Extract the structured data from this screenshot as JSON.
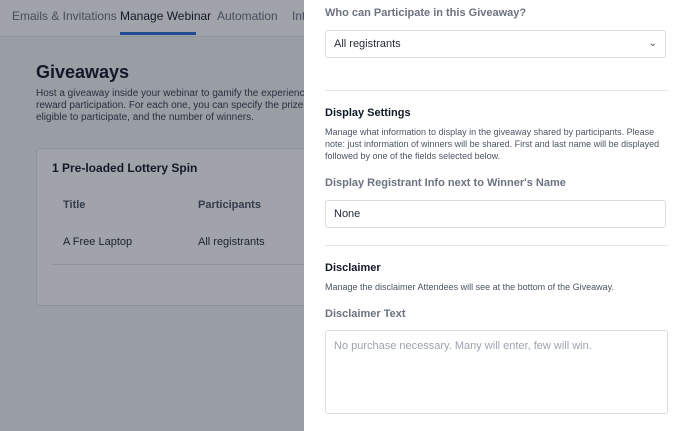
{
  "tabs": [
    {
      "label": "Emails & Invitations"
    },
    {
      "label": "Manage Webinar",
      "active": true
    },
    {
      "label": "Automation"
    },
    {
      "label": "Int"
    }
  ],
  "giveaways": {
    "title": "Giveaways",
    "description": "Host a giveaway inside your webinar to gamify the experience and reward participation. For each one, you can specify the prize, who's eligible to participate, and the number of winners.",
    "description_lines": [
      "Host a giveaway inside your webinar to gamify the experience and",
      "reward participation. For each one, you can specify the prize, who's",
      "eligible to participate, and the number of winners."
    ],
    "card_title": "1 Pre-loaded Lottery Spin",
    "columns": [
      "Title",
      "Participants"
    ],
    "rows": [
      {
        "title": "A Free Laptop",
        "participants": "All registrants"
      }
    ]
  },
  "drawer": {
    "participate_label": "Who can Participate in this Giveaway?",
    "participate_value": "All registrants",
    "display_heading": "Display Settings",
    "display_help": "Manage what information to display in the giveaway shared by participants. Please note: just information of winners will be shared. First and last name will be displayed followed by one of the fields selected below.",
    "registrant_label": "Display Registrant Info next to Winner's Name",
    "registrant_value": "None",
    "disclaimer_heading": "Disclaimer",
    "disclaimer_help": "Manage the disclaimer Attendees will see at the bottom of the Giveaway.",
    "disclaimer_label": "Disclaimer Text",
    "disclaimer_placeholder": "No purchase necessary. Many will enter, few will win.",
    "disclaimer_value": ""
  },
  "icons": {
    "select_chevron": "chevron-down-icon"
  },
  "colors": {
    "accent": "#2f6fd6",
    "overlay": "rgba(17,24,39,0.4)"
  }
}
